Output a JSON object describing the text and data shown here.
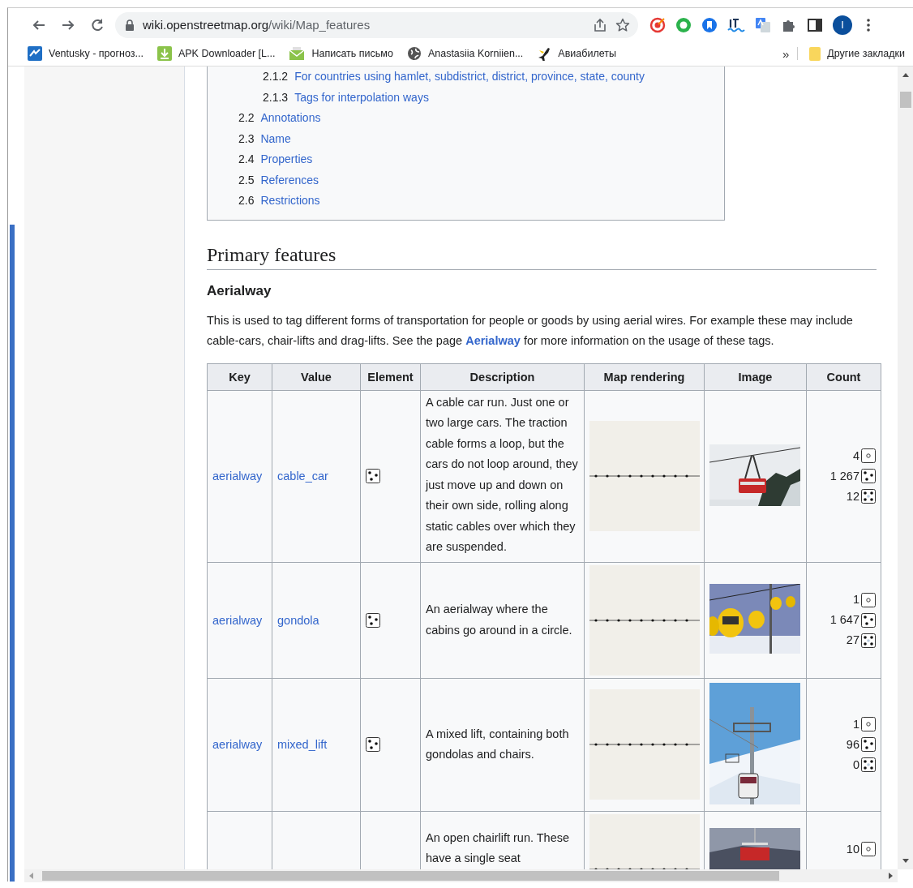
{
  "browser": {
    "address": {
      "host": "wiki.openstreetmap.org",
      "path": "/wiki/Map_features"
    },
    "profile_initial": "I",
    "bookmarks": [
      {
        "label": "Ventusky - прогноз...",
        "kind": "ventusky"
      },
      {
        "label": "APK Downloader [L...",
        "kind": "download"
      },
      {
        "label": "Написать письмо",
        "kind": "mail"
      },
      {
        "label": "Anastasiia Korniien...",
        "kind": "globe"
      },
      {
        "label": "Авиабилеты",
        "kind": "plane"
      }
    ],
    "overflow": "»",
    "other_bookmarks": "Другие закладки"
  },
  "toc": {
    "items": [
      {
        "children": [
          {
            "number": "2.1.2",
            "label": "For countries using hamlet, subdistrict, district, province, state, county"
          },
          {
            "number": "2.1.3",
            "label": "Tags for interpolation ways"
          }
        ]
      },
      {
        "number": "2.2",
        "label": "Annotations"
      },
      {
        "number": "2.3",
        "label": "Name"
      },
      {
        "number": "2.4",
        "label": "Properties"
      },
      {
        "number": "2.5",
        "label": "References"
      },
      {
        "number": "2.6",
        "label": "Restrictions"
      }
    ]
  },
  "heading": "Primary features",
  "subheading": "Aerialway",
  "intro": {
    "before": "This is used to tag different forms of transportation for people or goods by using aerial wires. For example these may include cable-cars, chair-lifts and drag-lifts. See the page ",
    "link": "Aerialway",
    "after": " for more information on the usage of these tags."
  },
  "table": {
    "columns": [
      "Key",
      "Value",
      "Element",
      "Description",
      "Map rendering",
      "Image",
      "Count"
    ],
    "rows": [
      {
        "key": "aerialway",
        "value": "cable_car",
        "element": {
          "kind": "way"
        },
        "description": "A cable car run. Just one or two large cars. The traction cable forms a loop, but the cars do not loop around, they just move up and down on their own side, rolling along static cables over which they are suspended.",
        "image": {
          "kind": "picture"
        },
        "counts": [
          {
            "value": "4",
            "kind": "node"
          },
          {
            "value": "1 267",
            "kind": "way"
          },
          {
            "value": "12",
            "kind": "relation"
          }
        ]
      },
      {
        "key": "aerialway",
        "value": "gondola",
        "element": {
          "kind": "way"
        },
        "description": "An aerialway where the cabins go around in a circle.",
        "image": {
          "kind": "picture"
        },
        "counts": [
          {
            "value": "1",
            "kind": "node"
          },
          {
            "value": "1 647",
            "kind": "way"
          },
          {
            "value": "27",
            "kind": "relation"
          }
        ]
      },
      {
        "key": "aerialway",
        "value": "mixed_lift",
        "element": {
          "kind": "way"
        },
        "description": "A mixed lift, containing both gondolas and chairs.",
        "image": {
          "kind": "picture"
        },
        "counts": [
          {
            "value": "1",
            "kind": "node"
          },
          {
            "value": "96",
            "kind": "way"
          },
          {
            "value": "0",
            "kind": "relation"
          }
        ]
      },
      {
        "description": "An open chairlift run. These have a single seat",
        "image": {
          "kind": "picture"
        },
        "counts": [
          {
            "value": "10",
            "kind": "node"
          }
        ]
      }
    ]
  }
}
